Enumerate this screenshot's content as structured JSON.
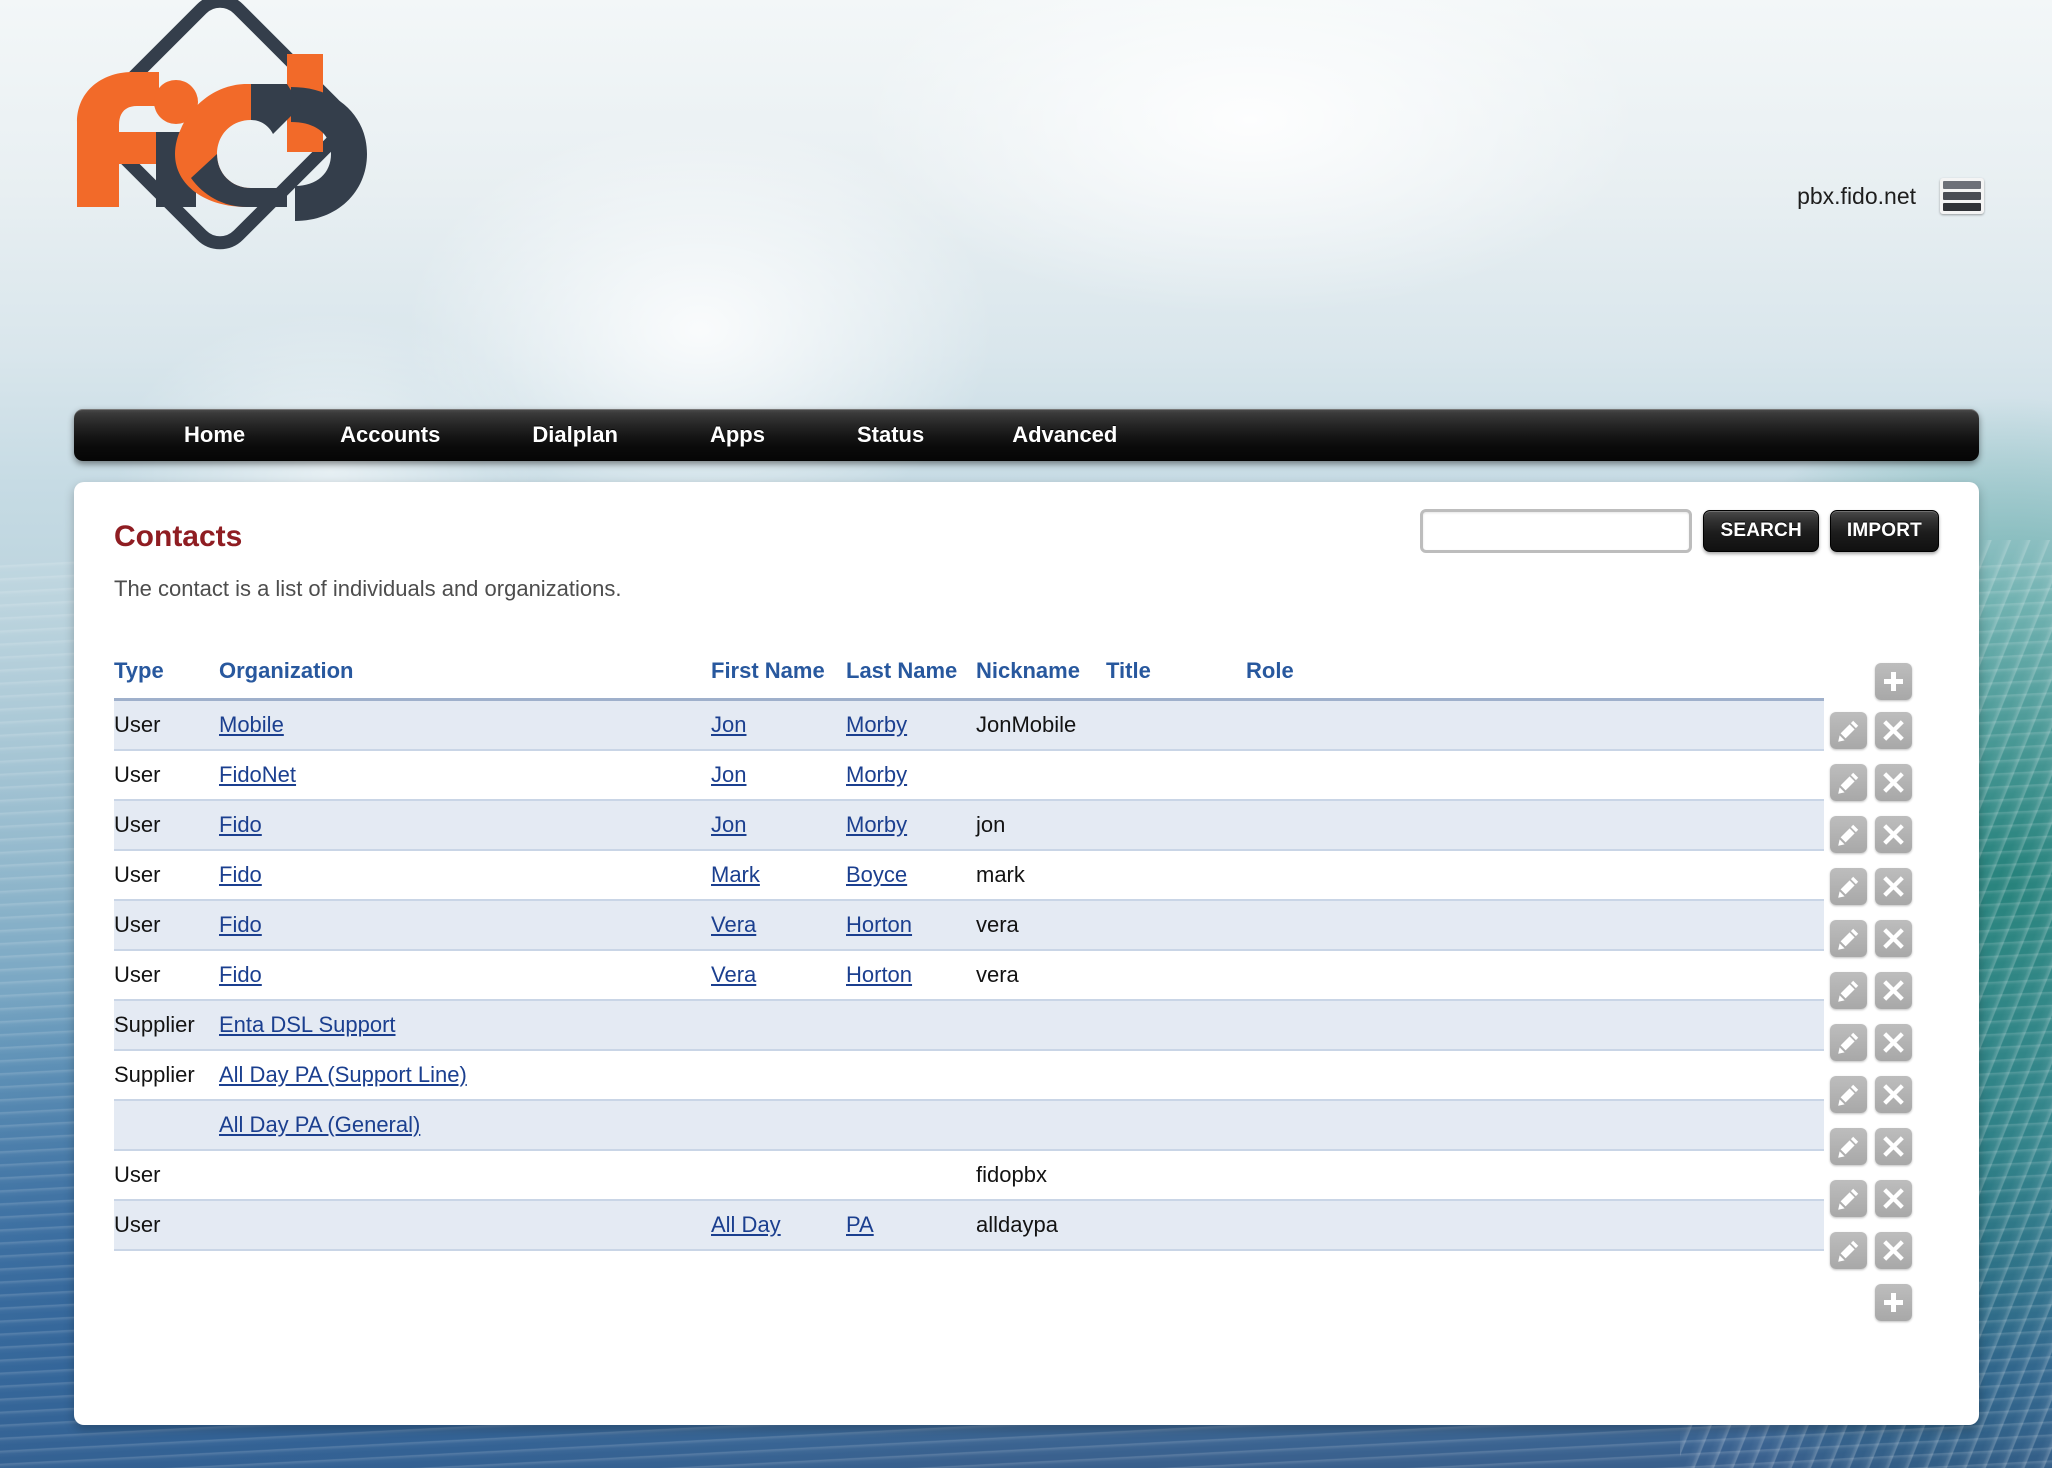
{
  "header": {
    "logo_text": "fido",
    "hostname": "pbx.fido.net",
    "menu_icon": "hamburger-icon"
  },
  "nav": {
    "items": [
      {
        "label": "Home"
      },
      {
        "label": "Accounts"
      },
      {
        "label": "Dialplan"
      },
      {
        "label": "Apps"
      },
      {
        "label": "Status"
      },
      {
        "label": "Advanced"
      }
    ]
  },
  "page": {
    "title": "Contacts",
    "subtitle": "The contact is a list of individuals and organizations.",
    "title_color": "#8f1d22"
  },
  "search": {
    "value": "",
    "placeholder": "",
    "search_label": "SEARCH",
    "import_label": "IMPORT"
  },
  "table": {
    "columns": [
      {
        "label": "Type"
      },
      {
        "label": "Organization"
      },
      {
        "label": "First Name"
      },
      {
        "label": "Last Name"
      },
      {
        "label": "Nickname"
      },
      {
        "label": "Title"
      },
      {
        "label": "Role"
      }
    ],
    "rows": [
      {
        "type": "User",
        "organization": "Mobile",
        "first_name": "Jon",
        "last_name": "Morby",
        "nickname": "JonMobile",
        "title": "",
        "role": ""
      },
      {
        "type": "User",
        "organization": "FidoNet",
        "first_name": "Jon",
        "last_name": "Morby",
        "nickname": "",
        "title": "",
        "role": ""
      },
      {
        "type": "User",
        "organization": "Fido",
        "first_name": "Jon",
        "last_name": "Morby",
        "nickname": "jon",
        "title": "",
        "role": ""
      },
      {
        "type": "User",
        "organization": "Fido",
        "first_name": "Mark",
        "last_name": "Boyce",
        "nickname": "mark",
        "title": "",
        "role": ""
      },
      {
        "type": "User",
        "organization": "Fido",
        "first_name": "Vera",
        "last_name": "Horton",
        "nickname": "vera",
        "title": "",
        "role": ""
      },
      {
        "type": "User",
        "organization": "Fido",
        "first_name": "Vera",
        "last_name": "Horton",
        "nickname": "vera",
        "title": "",
        "role": ""
      },
      {
        "type": "Supplier",
        "organization": "Enta DSL Support",
        "first_name": "",
        "last_name": "",
        "nickname": "",
        "title": "",
        "role": ""
      },
      {
        "type": "Supplier",
        "organization": "All Day PA (Support Line)",
        "first_name": "",
        "last_name": "",
        "nickname": "",
        "title": "",
        "role": ""
      },
      {
        "type": "",
        "organization": "All Day PA (General)",
        "first_name": "",
        "last_name": "",
        "nickname": "",
        "title": "",
        "role": ""
      },
      {
        "type": "User",
        "organization": "",
        "first_name": "",
        "last_name": "",
        "nickname": "fidopbx",
        "title": "",
        "role": ""
      },
      {
        "type": "User",
        "organization": "",
        "first_name": "All Day",
        "last_name": "PA",
        "nickname": "alldaypa",
        "title": "",
        "role": ""
      }
    ],
    "row_actions": {
      "edit_icon": "pencil-icon",
      "delete_icon": "close-x-icon"
    },
    "add_icon": "plus-icon"
  }
}
